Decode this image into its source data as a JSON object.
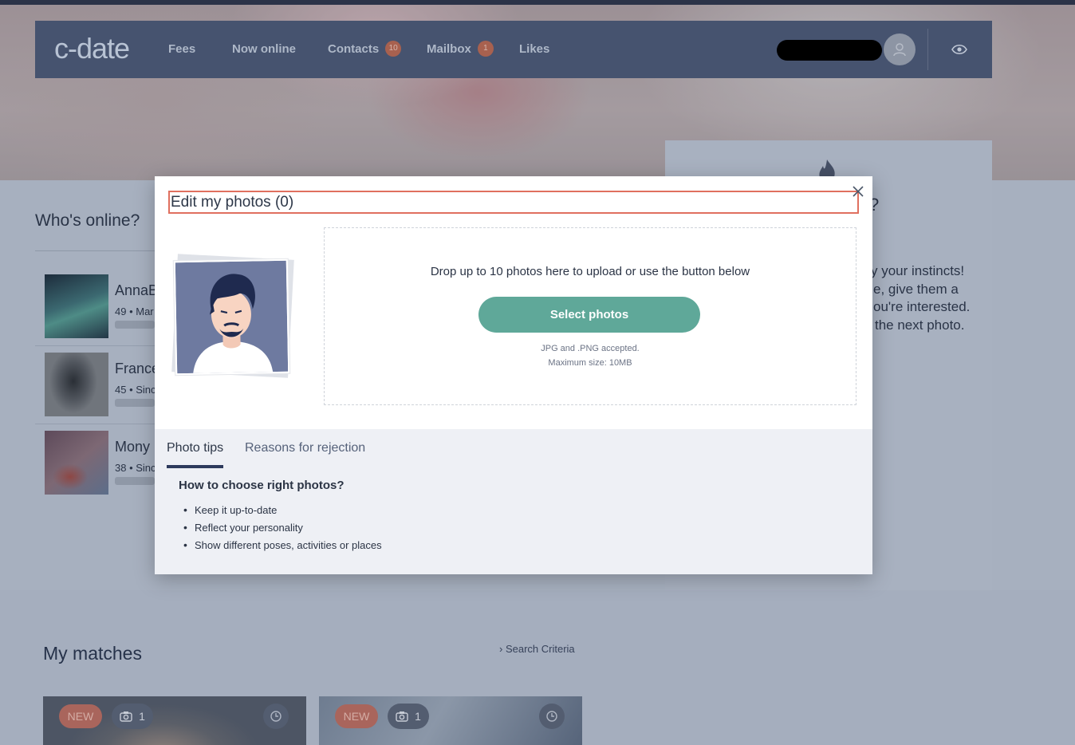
{
  "nav": {
    "logo": "c-date",
    "items": [
      {
        "label": "Fees"
      },
      {
        "label": "Now online"
      },
      {
        "label": "Contacts",
        "badge": "10"
      },
      {
        "label": "Mailbox",
        "badge": "1"
      },
      {
        "label": "Likes"
      }
    ]
  },
  "background": {
    "whos_online_title": "Who's online?",
    "online_users": [
      {
        "name": "AnnaB",
        "meta": "49 • Mar"
      },
      {
        "name": "France",
        "meta": "45 • Sinc"
      },
      {
        "name": "Mony",
        "meta": "38 • Sinc"
      }
    ],
    "right_text": [
      "?",
      "y your instincts!",
      "e, give them a",
      "ou're interested.",
      "the next photo."
    ],
    "my_matches_title": "My matches",
    "search_criteria_label": "Search Criteria",
    "matches": [
      {
        "tag": "NEW",
        "photo_count": "1"
      },
      {
        "tag": "NEW",
        "photo_count": "1"
      }
    ]
  },
  "modal": {
    "title": "Edit my photos (0)",
    "drop_text": "Drop up to 10 photos here to upload or use the button below",
    "select_button": "Select photos",
    "accepted_line1": "JPG and .PNG accepted.",
    "accepted_line2": "Maximum size: 10MB",
    "tabs": [
      {
        "label": "Photo tips",
        "active": true
      },
      {
        "label": "Reasons for rejection",
        "active": false
      }
    ],
    "tips_heading": "How to choose right photos?",
    "tips": [
      "Keep it up-to-date",
      "Reflect your personality",
      "Show different poses, activities or places"
    ]
  },
  "colors": {
    "navbar": "#46536f",
    "accent_button": "#5fa899",
    "badge": "#a8614f",
    "title_highlight": "#e0705f"
  }
}
